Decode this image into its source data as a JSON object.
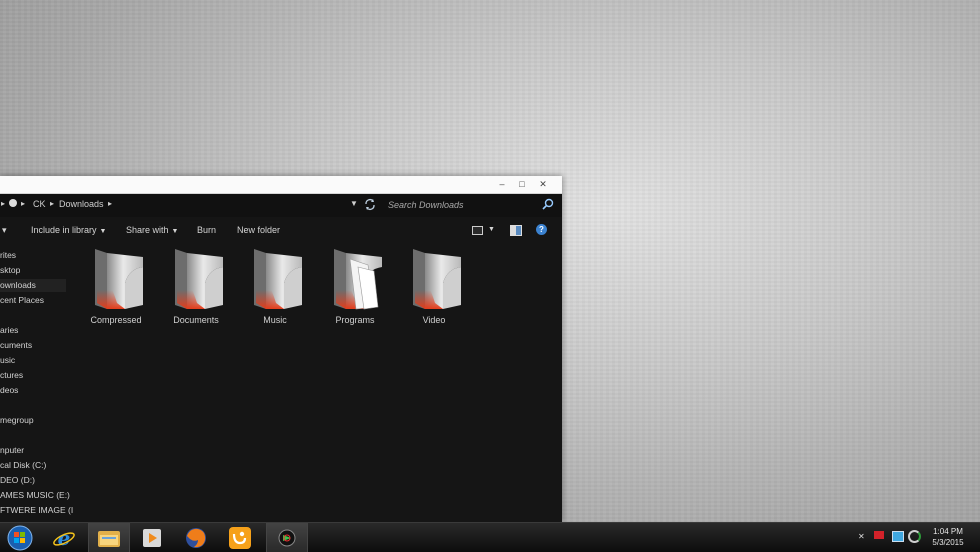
{
  "explorer": {
    "address": {
      "crumbs": [
        "CK",
        "Downloads"
      ],
      "search_placeholder": "Search Downloads"
    },
    "toolbar": {
      "organize_arrow": "▾",
      "include_label": "Include in library",
      "share_label": "Share with",
      "burn_label": "Burn",
      "new_folder_label": "New folder"
    },
    "nav": {
      "items": [
        "rites",
        "sktop",
        "ownloads",
        "cent Places",
        "aries",
        "cuments",
        "usic",
        "ctures",
        "deos",
        "megroup",
        "nputer",
        "cal Disk (C:)",
        "DEO (D:)",
        "AMES MUSIC (E:)",
        "FTWERE IMAGE (I"
      ],
      "selected_index": 2
    },
    "folders": [
      "Compressed",
      "Documents",
      "Music",
      "Programs",
      "Video"
    ]
  },
  "taskbar": {
    "apps": [
      "start-orb",
      "internet-explorer",
      "file-explorer",
      "media-player",
      "firefox",
      "uc-browser",
      "media-center"
    ],
    "active_app": "file-explorer",
    "clock": {
      "time": "1:04 PM",
      "date": "5/3/2015"
    }
  }
}
